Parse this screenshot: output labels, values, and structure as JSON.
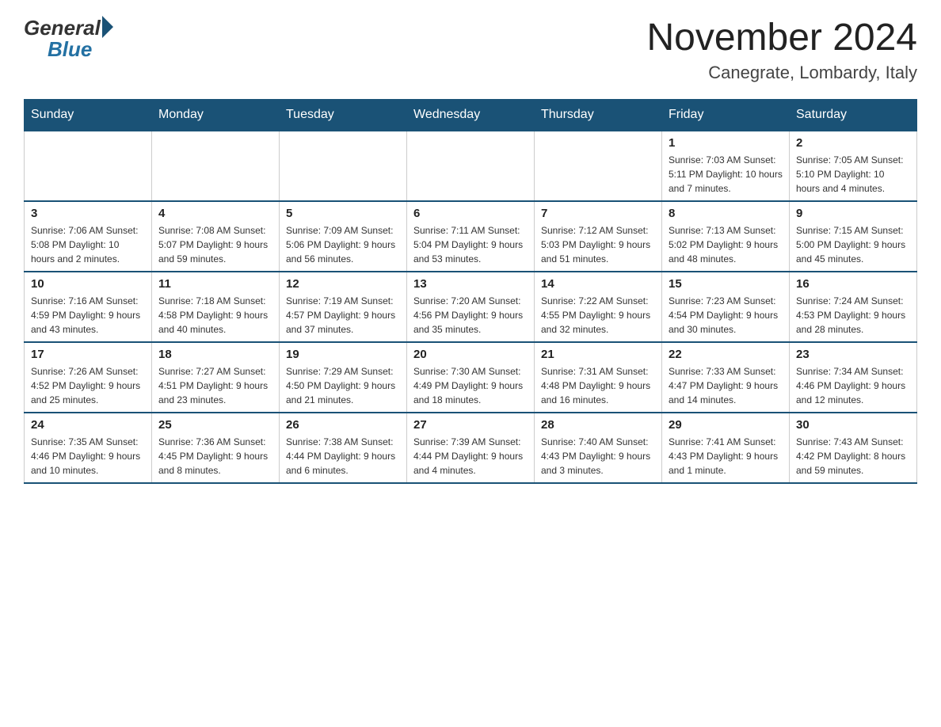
{
  "logo": {
    "general": "General",
    "blue": "Blue"
  },
  "title": {
    "month_year": "November 2024",
    "location": "Canegrate, Lombardy, Italy"
  },
  "weekdays": [
    "Sunday",
    "Monday",
    "Tuesday",
    "Wednesday",
    "Thursday",
    "Friday",
    "Saturday"
  ],
  "weeks": [
    [
      {
        "day": "",
        "info": ""
      },
      {
        "day": "",
        "info": ""
      },
      {
        "day": "",
        "info": ""
      },
      {
        "day": "",
        "info": ""
      },
      {
        "day": "",
        "info": ""
      },
      {
        "day": "1",
        "info": "Sunrise: 7:03 AM\nSunset: 5:11 PM\nDaylight: 10 hours and 7 minutes."
      },
      {
        "day": "2",
        "info": "Sunrise: 7:05 AM\nSunset: 5:10 PM\nDaylight: 10 hours and 4 minutes."
      }
    ],
    [
      {
        "day": "3",
        "info": "Sunrise: 7:06 AM\nSunset: 5:08 PM\nDaylight: 10 hours and 2 minutes."
      },
      {
        "day": "4",
        "info": "Sunrise: 7:08 AM\nSunset: 5:07 PM\nDaylight: 9 hours and 59 minutes."
      },
      {
        "day": "5",
        "info": "Sunrise: 7:09 AM\nSunset: 5:06 PM\nDaylight: 9 hours and 56 minutes."
      },
      {
        "day": "6",
        "info": "Sunrise: 7:11 AM\nSunset: 5:04 PM\nDaylight: 9 hours and 53 minutes."
      },
      {
        "day": "7",
        "info": "Sunrise: 7:12 AM\nSunset: 5:03 PM\nDaylight: 9 hours and 51 minutes."
      },
      {
        "day": "8",
        "info": "Sunrise: 7:13 AM\nSunset: 5:02 PM\nDaylight: 9 hours and 48 minutes."
      },
      {
        "day": "9",
        "info": "Sunrise: 7:15 AM\nSunset: 5:00 PM\nDaylight: 9 hours and 45 minutes."
      }
    ],
    [
      {
        "day": "10",
        "info": "Sunrise: 7:16 AM\nSunset: 4:59 PM\nDaylight: 9 hours and 43 minutes."
      },
      {
        "day": "11",
        "info": "Sunrise: 7:18 AM\nSunset: 4:58 PM\nDaylight: 9 hours and 40 minutes."
      },
      {
        "day": "12",
        "info": "Sunrise: 7:19 AM\nSunset: 4:57 PM\nDaylight: 9 hours and 37 minutes."
      },
      {
        "day": "13",
        "info": "Sunrise: 7:20 AM\nSunset: 4:56 PM\nDaylight: 9 hours and 35 minutes."
      },
      {
        "day": "14",
        "info": "Sunrise: 7:22 AM\nSunset: 4:55 PM\nDaylight: 9 hours and 32 minutes."
      },
      {
        "day": "15",
        "info": "Sunrise: 7:23 AM\nSunset: 4:54 PM\nDaylight: 9 hours and 30 minutes."
      },
      {
        "day": "16",
        "info": "Sunrise: 7:24 AM\nSunset: 4:53 PM\nDaylight: 9 hours and 28 minutes."
      }
    ],
    [
      {
        "day": "17",
        "info": "Sunrise: 7:26 AM\nSunset: 4:52 PM\nDaylight: 9 hours and 25 minutes."
      },
      {
        "day": "18",
        "info": "Sunrise: 7:27 AM\nSunset: 4:51 PM\nDaylight: 9 hours and 23 minutes."
      },
      {
        "day": "19",
        "info": "Sunrise: 7:29 AM\nSunset: 4:50 PM\nDaylight: 9 hours and 21 minutes."
      },
      {
        "day": "20",
        "info": "Sunrise: 7:30 AM\nSunset: 4:49 PM\nDaylight: 9 hours and 18 minutes."
      },
      {
        "day": "21",
        "info": "Sunrise: 7:31 AM\nSunset: 4:48 PM\nDaylight: 9 hours and 16 minutes."
      },
      {
        "day": "22",
        "info": "Sunrise: 7:33 AM\nSunset: 4:47 PM\nDaylight: 9 hours and 14 minutes."
      },
      {
        "day": "23",
        "info": "Sunrise: 7:34 AM\nSunset: 4:46 PM\nDaylight: 9 hours and 12 minutes."
      }
    ],
    [
      {
        "day": "24",
        "info": "Sunrise: 7:35 AM\nSunset: 4:46 PM\nDaylight: 9 hours and 10 minutes."
      },
      {
        "day": "25",
        "info": "Sunrise: 7:36 AM\nSunset: 4:45 PM\nDaylight: 9 hours and 8 minutes."
      },
      {
        "day": "26",
        "info": "Sunrise: 7:38 AM\nSunset: 4:44 PM\nDaylight: 9 hours and 6 minutes."
      },
      {
        "day": "27",
        "info": "Sunrise: 7:39 AM\nSunset: 4:44 PM\nDaylight: 9 hours and 4 minutes."
      },
      {
        "day": "28",
        "info": "Sunrise: 7:40 AM\nSunset: 4:43 PM\nDaylight: 9 hours and 3 minutes."
      },
      {
        "day": "29",
        "info": "Sunrise: 7:41 AM\nSunset: 4:43 PM\nDaylight: 9 hours and 1 minute."
      },
      {
        "day": "30",
        "info": "Sunrise: 7:43 AM\nSunset: 4:42 PM\nDaylight: 8 hours and 59 minutes."
      }
    ]
  ]
}
